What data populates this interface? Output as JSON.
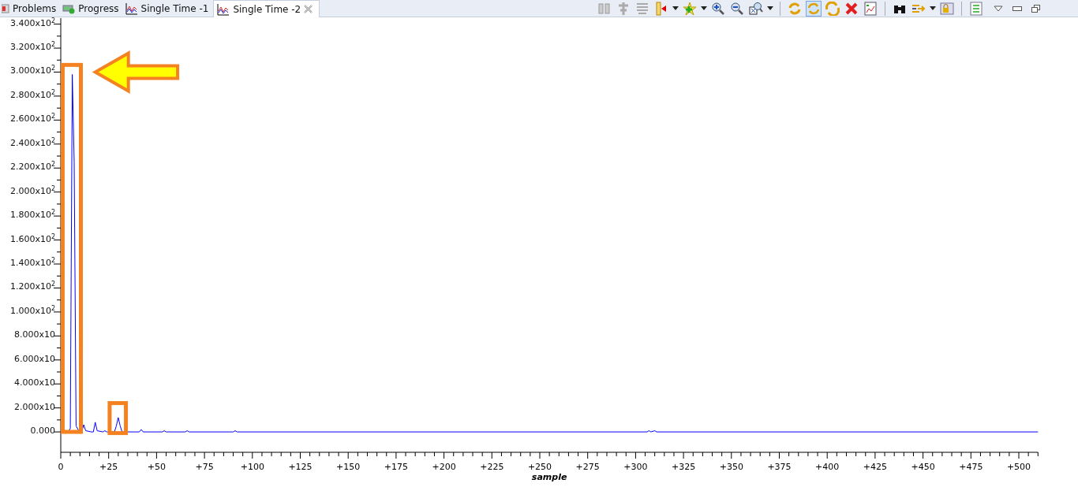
{
  "tabs": [
    {
      "label": "Problems",
      "selected": false
    },
    {
      "label": "Progress",
      "selected": false
    },
    {
      "label": "Single Time -1",
      "selected": false
    },
    {
      "label": "Single Time -2",
      "selected": true
    }
  ],
  "toolbar_buttons": [
    {
      "selected": false
    },
    {
      "selected": false
    },
    {
      "selected": false
    },
    {
      "selected": false
    },
    {
      "selected": false
    },
    {
      "selected": false
    },
    {
      "selected": false
    },
    {
      "selected": false
    },
    {
      "selected": false
    },
    {
      "selected": true
    },
    {
      "selected": false
    },
    {
      "selected": false
    },
    {
      "selected": false
    },
    {
      "selected": false
    },
    {
      "selected": false
    },
    {
      "selected": false
    },
    {
      "selected": false
    }
  ],
  "chart_data": {
    "type": "line",
    "xlabel": "sample",
    "xlim": [
      0,
      510
    ],
    "ylim": [
      -17,
      345
    ],
    "x": [
      4,
      5,
      6,
      7,
      8,
      9,
      10,
      11,
      12,
      13,
      16,
      17,
      18,
      19,
      22,
      23,
      24,
      28,
      29,
      30,
      31,
      32,
      41,
      42,
      43,
      53,
      54,
      55,
      65,
      66,
      67,
      90,
      91,
      92,
      306,
      307,
      308,
      310,
      311,
      510
    ],
    "series": [
      {
        "color": "#0000ff",
        "values": [
          0,
          3,
          298,
          225,
          5,
          2,
          0,
          0,
          6,
          1,
          0,
          0,
          8,
          1,
          0,
          1,
          0,
          0,
          5,
          12,
          5,
          0,
          0,
          2,
          0,
          0,
          1,
          0,
          0,
          1,
          0,
          0,
          1,
          0,
          0,
          1,
          0,
          1,
          0,
          0
        ]
      }
    ],
    "xticks": [
      {
        "value": 0,
        "label": "0"
      },
      {
        "value": 25,
        "label": "+25"
      },
      {
        "value": 50,
        "label": "+50"
      },
      {
        "value": 75,
        "label": "+75"
      },
      {
        "value": 100,
        "label": "+100"
      },
      {
        "value": 125,
        "label": "+125"
      },
      {
        "value": 150,
        "label": "+150"
      },
      {
        "value": 175,
        "label": "+175"
      },
      {
        "value": 200,
        "label": "+200"
      },
      {
        "value": 225,
        "label": "+225"
      },
      {
        "value": 250,
        "label": "+250"
      },
      {
        "value": 275,
        "label": "+275"
      },
      {
        "value": 300,
        "label": "+300"
      },
      {
        "value": 325,
        "label": "+325"
      },
      {
        "value": 350,
        "label": "+350"
      },
      {
        "value": 375,
        "label": "+375"
      },
      {
        "value": 400,
        "label": "+400"
      },
      {
        "value": 425,
        "label": "+425"
      },
      {
        "value": 450,
        "label": "+450"
      },
      {
        "value": 475,
        "label": "+475"
      },
      {
        "value": 500,
        "label": "+500"
      }
    ],
    "yticks": [
      {
        "value": 0,
        "label": "0.000"
      },
      {
        "value": 20,
        "label": "2.000x10"
      },
      {
        "value": 40,
        "label": "4.000x10"
      },
      {
        "value": 60,
        "label": "6.000x10"
      },
      {
        "value": 80,
        "label": "8.000x10"
      },
      {
        "value": 100,
        "label": "1.000x10$^{2}$"
      },
      {
        "value": 120,
        "label": "1.200x10$^{2}$"
      },
      {
        "value": 140,
        "label": "1.400x10$^{2}$"
      },
      {
        "value": 160,
        "label": "1.600x10$^{2}$"
      },
      {
        "value": 180,
        "label": "1.800x10$^{2}$"
      },
      {
        "value": 200,
        "label": "2.000x10$^{2}$"
      },
      {
        "value": 220,
        "label": "2.200x10$^{2}$"
      },
      {
        "value": 240,
        "label": "2.400x10$^{2}$"
      },
      {
        "value": 260,
        "label": "2.600x10$^{2}$"
      },
      {
        "value": 280,
        "label": "2.800x10$^{2}$"
      },
      {
        "value": 300,
        "label": "3.000x10$^{2}$"
      },
      {
        "value": 320,
        "label": "3.200x10$^{2}$"
      },
      {
        "value": 340,
        "label": "3.400x10$^{2}$"
      }
    ]
  }
}
